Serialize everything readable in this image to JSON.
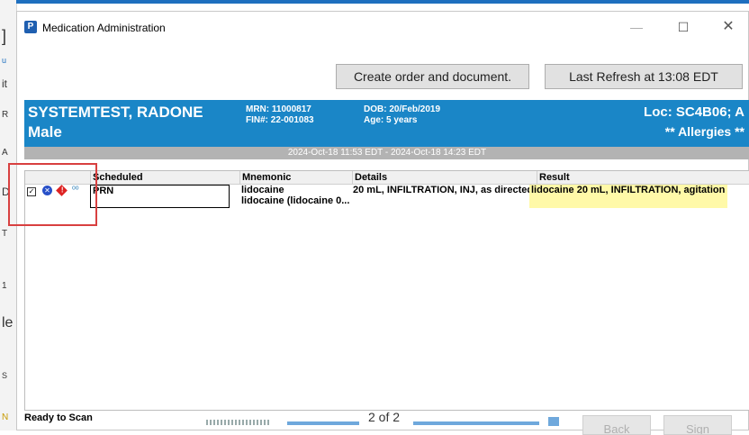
{
  "window": {
    "title": "Medication Administration",
    "icon_letter": "P"
  },
  "toolbar": {
    "create_label": "Create order and document.",
    "refresh_label": "Last Refresh at 13:08 EDT"
  },
  "patient": {
    "name": "SYSTEMTEST, RADONE",
    "sex": "Male",
    "mrn": "MRN: 11000817",
    "fin": "FIN#: 22-001083",
    "dob": "DOB: 20/Feb/2019",
    "age": "Age: 5 years",
    "location": "Loc: SC4B06; A",
    "allergies": "** Allergies **"
  },
  "time_range": "2024-Oct-18 11:53 EDT - 2024-Oct-18 14:23 EDT",
  "grid": {
    "headers": {
      "scheduled": "Scheduled",
      "mnemonic": "Mnemonic",
      "details": "Details",
      "result": "Result"
    },
    "rows": [
      {
        "scheduled": "PRN",
        "mnemonic_line1": "lidocaine",
        "mnemonic_line2": "lidocaine (lidocaine 0....",
        "details": "20 mL, INFILTRATION, INJ, as directed...",
        "result": "lidocaine 20 mL, INFILTRATION, agitation"
      }
    ]
  },
  "footer": {
    "status": "Ready to Scan",
    "pager": "2 of 2",
    "back_label": "Back",
    "sign_label": "Sign"
  },
  "background_fragments": [
    "]",
    "u",
    "it",
    "R",
    "A",
    "D",
    "T",
    "1",
    "le",
    "S",
    "N"
  ],
  "colors": {
    "banner": "#1a86c7",
    "result_highlight": "#fff9a8",
    "annotation": "#d84040"
  }
}
